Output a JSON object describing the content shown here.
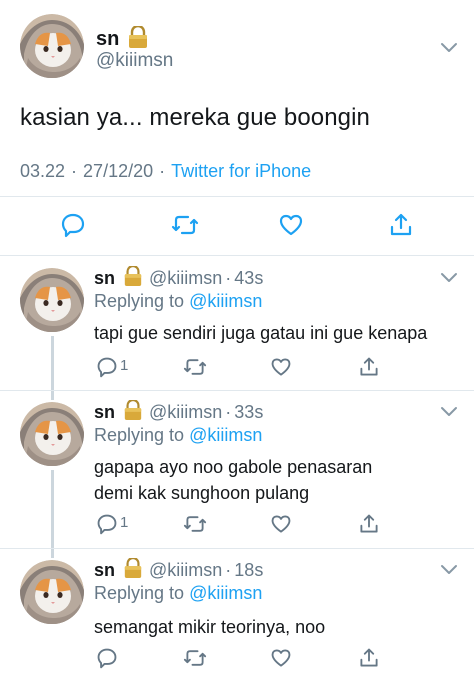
{
  "colors": {
    "accent": "#1da1f2",
    "secondary_text": "#657786",
    "divider": "#e1e8ed",
    "thread_line": "#ccd6dd"
  },
  "main_tweet": {
    "display_name": "sn",
    "handle": "@kiiimsn",
    "text": "kasian ya... mereka gue boongin",
    "time": "03.22",
    "date": "27/12/20",
    "source": "Twitter for iPhone",
    "icons": [
      "lock-icon",
      "chevron-down-icon",
      "reply-icon",
      "retweet-icon",
      "like-icon",
      "share-icon"
    ]
  },
  "replies": [
    {
      "display_name": "sn",
      "handle": "@kiiimsn",
      "time": "43s",
      "replying_prefix": "Replying to",
      "replying_to": "@kiiimsn",
      "text": "tapi gue sendiri juga gatau ini gue kenapa",
      "reply_count": "1"
    },
    {
      "display_name": "sn",
      "handle": "@kiiimsn",
      "time": "33s",
      "replying_prefix": "Replying to",
      "replying_to": "@kiiimsn",
      "text": "gapapa ayo noo gabole penasaran demi kak sunghoon pulang",
      "reply_count": "1"
    },
    {
      "display_name": "sn",
      "handle": "@kiiimsn",
      "time": "18s",
      "replying_prefix": "Replying to",
      "replying_to": "@kiiimsn",
      "text": "semangat mikir teorinya, noo",
      "reply_count": ""
    }
  ]
}
